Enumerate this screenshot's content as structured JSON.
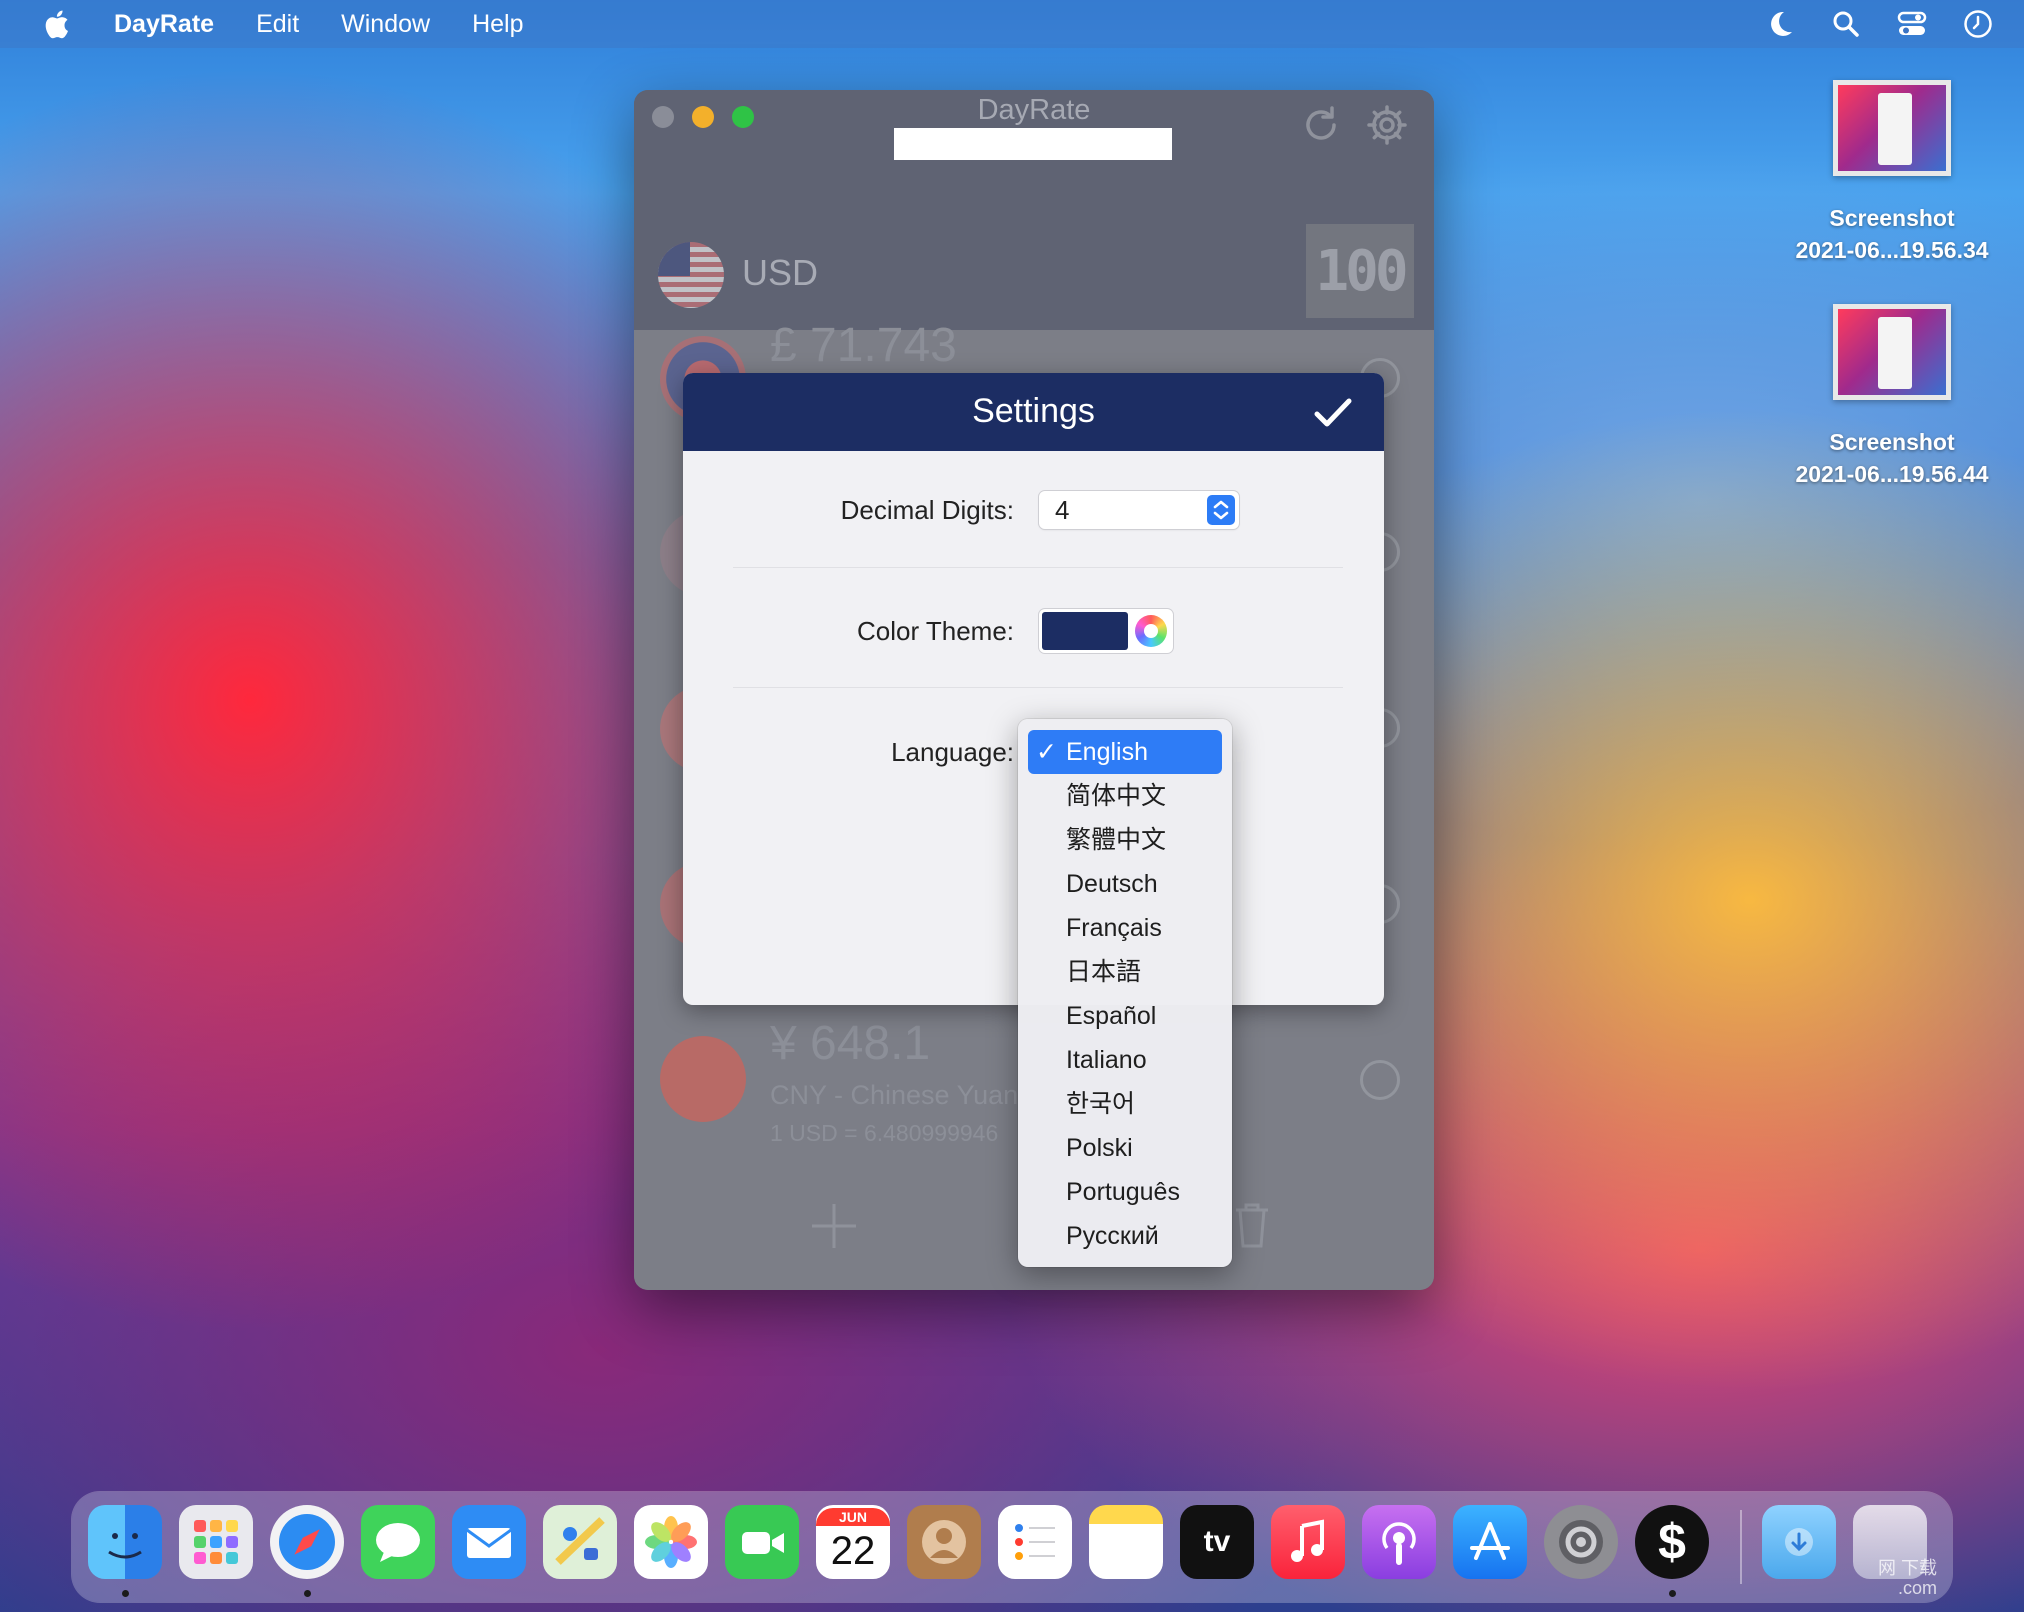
{
  "menubar": {
    "app_name": "DayRate",
    "items": [
      "Edit",
      "Window",
      "Help"
    ]
  },
  "desktop": {
    "icons": [
      {
        "name_line1": "Screenshot",
        "name_line2": "2021-06...19.56.34"
      },
      {
        "name_line1": "Screenshot",
        "name_line2": "2021-06...19.56.44"
      }
    ]
  },
  "window": {
    "title": "DayRate",
    "base_currency": "USD",
    "base_amount": "100",
    "rows": [
      {
        "amount": "£ 71.743"
      },
      {
        "amount": "¥ 648.1",
        "name": "CNY - Chinese Yuan",
        "rate": "1 USD = 6.480999946"
      }
    ]
  },
  "settings": {
    "title": "Settings",
    "decimal_label": "Decimal Digits:",
    "decimal_value": "4",
    "color_label": "Color Theme:",
    "language_label": "Language:",
    "theme_color": "#1c2d63"
  },
  "language_menu": {
    "selected": "English",
    "options": [
      "English",
      "简体中文",
      "繁體中文",
      "Deutsch",
      "Français",
      "日本語",
      "Español",
      "Italiano",
      "한국어",
      "Polski",
      "Português",
      "Русский"
    ]
  },
  "dock": {
    "calendar_month": "JUN",
    "calendar_day": "22",
    "tv_label": "tv"
  },
  "watermark": {
    "line1": "网 下载",
    "line2": ".com"
  },
  "colors": {
    "accent": "#2e7cf6",
    "sheet_header": "#1c2d63",
    "traffic_min": "#f3b02b",
    "traffic_max": "#2fc346"
  }
}
